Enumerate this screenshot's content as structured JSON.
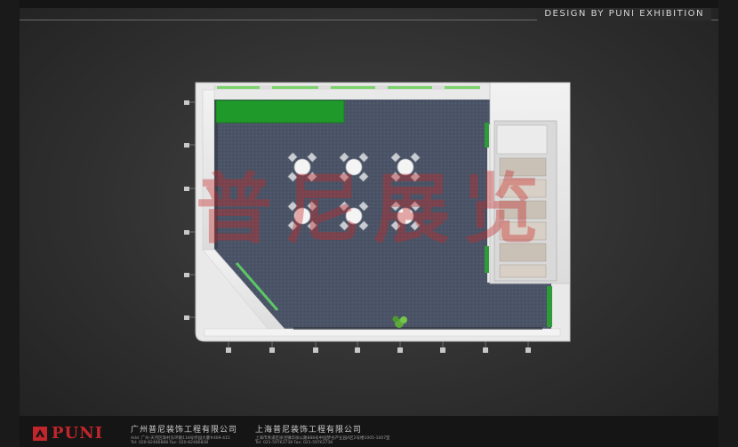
{
  "header": {
    "title": "DESIGN BY PUNI EXHIBITION"
  },
  "watermark": {
    "text": "普尼展览"
  },
  "footer": {
    "logo_text": "PUNI",
    "companies": [
      {
        "name": "广州普尼装饰工程有限公司",
        "address": "Add: 广州·天河区珠村东环路118号侨园大厦#409-415",
        "tel": "Tel: 020-82486888    Fax: 020-82486838"
      },
      {
        "name": "上海普尼装饰工程有限公司",
        "address": "上海市青浦区徐泾镇华徐公路888号中国梦谷产业园A区2号楼1005-1007室",
        "tel": "Tel: 021-59763738    Fax: 021-59763738"
      }
    ]
  },
  "colors": {
    "brand_red": "#c0262b",
    "green_panel": "#1f9a2a",
    "carpet": "#4a5568",
    "wall": "#e6e6e6"
  }
}
